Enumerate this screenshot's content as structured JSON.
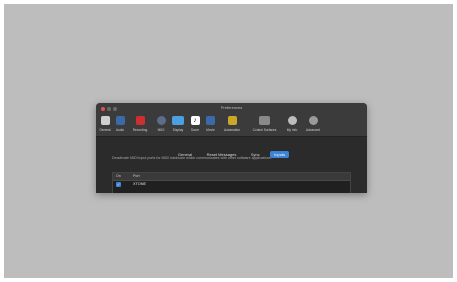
{
  "window": {
    "title": "Preferences"
  },
  "toolbar": {
    "items": [
      {
        "label": "General",
        "color": "#cfcfcf"
      },
      {
        "label": "Audio",
        "color": "#3a6aa8"
      },
      {
        "label": "Recording",
        "color": "#cc2f2f"
      },
      {
        "label": "MIDI",
        "color": "#5e6b8c"
      },
      {
        "label": "Display",
        "color": "#4aa0e0"
      },
      {
        "label": "Score",
        "color": "#ffffff"
      },
      {
        "label": "Movie",
        "color": "#3a6aa8"
      },
      {
        "label": "Automation",
        "color": "#c7a82a"
      },
      {
        "label": "Control Surfaces",
        "color": "#8a8a8a"
      },
      {
        "label": "My Info",
        "color": "#bdbdbd"
      },
      {
        "label": "Advanced",
        "color": "#9a9a9a"
      }
    ]
  },
  "tabs": [
    {
      "label": "General",
      "active": false
    },
    {
      "label": "Reset Messages",
      "active": false
    },
    {
      "label": "Sync",
      "active": false
    },
    {
      "label": "Inputs",
      "active": true
    }
  ],
  "inputs": {
    "description": "Deactivate MIDI input ports for MIDI hardware which communicates with other software applications.",
    "columns": {
      "on": "On",
      "port": "Port"
    },
    "rows": [
      {
        "on": true,
        "port": "XTONE"
      }
    ]
  },
  "colors": {
    "accent": "#3b84d6",
    "close": "#e0524b"
  }
}
